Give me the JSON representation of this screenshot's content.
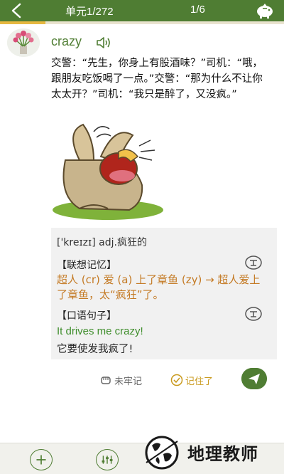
{
  "header": {
    "unit": "单元1/272",
    "page": "1/6",
    "progress_fraction": 0.16
  },
  "word": {
    "text": "crazy",
    "story": "交警：“先生，你身上有股酒味？”司机：“哦，跟朋友吃饭喝了一点。”交警：“那为什么不让你太太开？”司机：“我只是醉了，又没疯。”"
  },
  "card": {
    "phonetic": "['kreɪzɪ] adj.疯狂的",
    "mnemonic_title": "【联想记忆】",
    "mnemonic": "超人 (cr) 爱 (a) 上了章鱼 (zy) → 超人爱上了章鱼，太“疯狂”了。",
    "sentence_title": "【口语句子】",
    "sentence_en": "It drives me crazy!",
    "sentence_zh": "它要使发我疯了!"
  },
  "actions": {
    "unremembered": "未牢记",
    "remembered": "记住了"
  },
  "watermark": {
    "text": "地理教师"
  },
  "colors": {
    "brand_green": "#4f7d33",
    "progress_yellow": "#e6b840",
    "mnemonic_orange": "#c47a24",
    "sentence_green": "#3f8e2c"
  }
}
